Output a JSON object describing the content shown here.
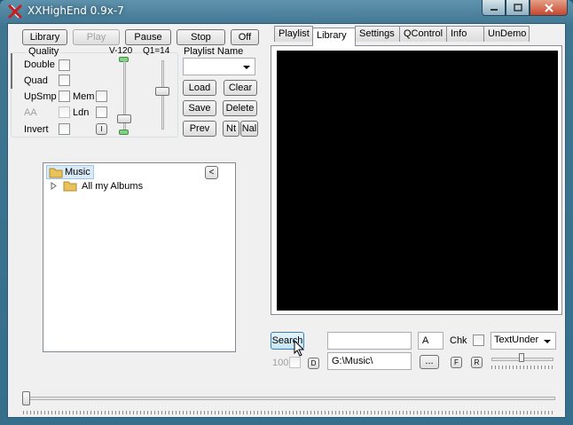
{
  "window": {
    "title": "XXHighEnd 0.9x-7"
  },
  "caption_buttons": {
    "minimize": "minimize-icon",
    "maximize": "maximize-icon",
    "close": "close-icon"
  },
  "transport": {
    "library": "Library",
    "play": "Play",
    "pause": "Pause",
    "stop": "Stop",
    "off": "Off"
  },
  "quality": {
    "group_label": "Quality",
    "double": "Double",
    "quad": "Quad",
    "upsmp": "UpSmp",
    "mem": "Mem",
    "aa": "AA",
    "ldn": "Ldn",
    "invert": "Invert",
    "i_button": "I",
    "volume_label": "V-120",
    "q1_label": "Q1=14"
  },
  "playlist": {
    "label": "Playlist Name",
    "value": "",
    "load": "Load",
    "clear": "Clear",
    "save": "Save",
    "delete": "Delete",
    "prev": "Prev",
    "nt": "Nt",
    "nal": "Nal"
  },
  "tree": {
    "collapse_button": "<",
    "root": "Music",
    "child": "All my Albums"
  },
  "tabs": [
    "Playlist",
    "Library",
    "Settings",
    "QControl",
    "Info",
    "UnDemo"
  ],
  "active_tab": "Library",
  "search": {
    "button": "Search",
    "query": "",
    "letter": "A",
    "chk_label": "Chk",
    "mode": "TextUnder",
    "count": "100",
    "d_button": "D",
    "path": "G:\\Music\\",
    "browse_button": "...",
    "f_button": "F",
    "r_button": "R"
  },
  "colors": {
    "accent": "#3c7fb1",
    "video_bg": "#000000",
    "level_led": "#7fd47f"
  }
}
